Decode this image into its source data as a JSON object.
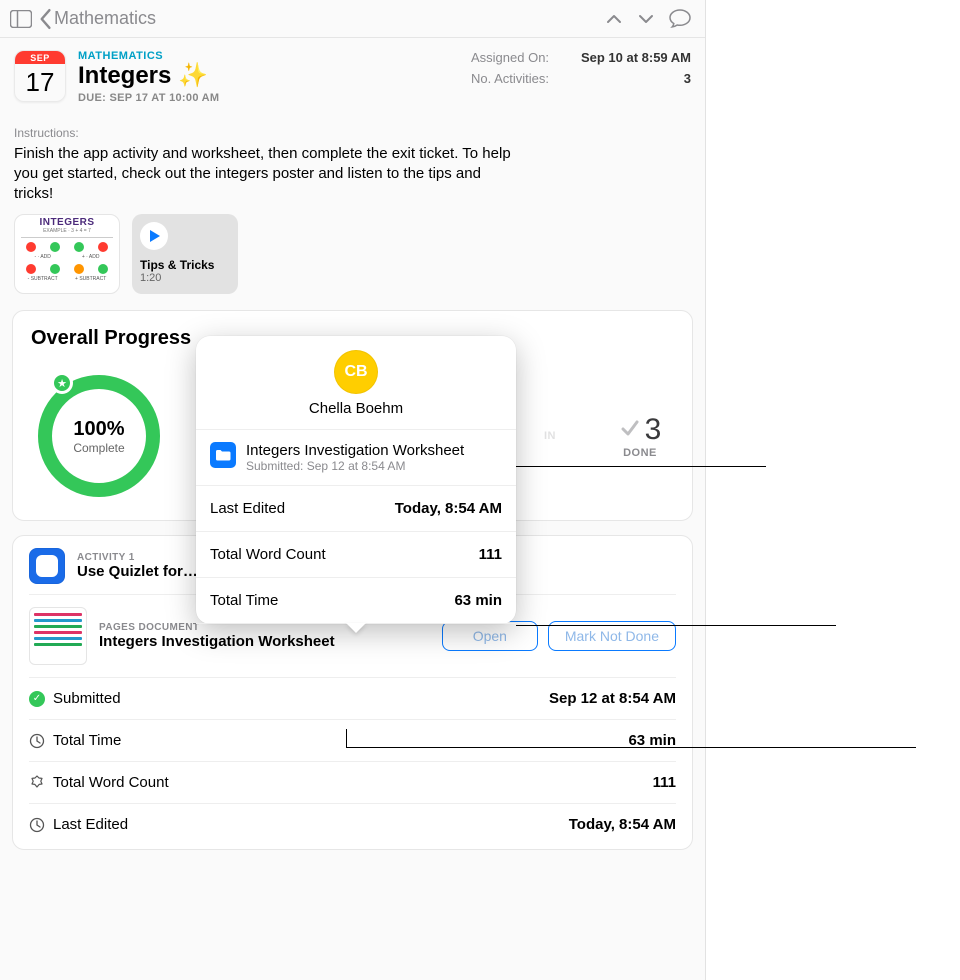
{
  "nav": {
    "back_label": "Mathematics"
  },
  "header": {
    "cal_month": "SEP",
    "cal_day": "17",
    "subject": "MATHEMATICS",
    "title": "Integers ✨",
    "due": "DUE: SEP 17 AT 10:00 AM",
    "meta": {
      "assigned_label": "Assigned On:",
      "assigned_value": "Sep 10 at 8:59 AM",
      "activities_label": "No. Activities:",
      "activities_value": "3"
    }
  },
  "instructions": {
    "label": "Instructions:",
    "text": "Finish the app activity and worksheet, then complete the exit ticket. To help you get started, check out the integers poster and listen to the tips and tricks!"
  },
  "attachments": {
    "poster_title": "INTEGERS",
    "media_title": "Tips & Tricks",
    "media_duration": "1:20"
  },
  "progress": {
    "heading": "Overall Progress",
    "percent": "100%",
    "percent_sub": "Complete",
    "done_num": "3",
    "done_label": "DONE"
  },
  "activity": {
    "label": "ACTIVITY 1",
    "title": "Use Quizlet for…",
    "doc_label": "PAGES DOCUMENT",
    "doc_title": "Integers Investigation Worksheet",
    "open_btn": "Open",
    "mark_btn": "Mark Not Done",
    "rows": {
      "submitted_label": "Submitted",
      "submitted_value": "Sep 12 at 8:54 AM",
      "time_label": "Total Time",
      "time_value": "63 min",
      "words_label": "Total Word Count",
      "words_value": "111",
      "edited_label": "Last Edited",
      "edited_value": "Today, 8:54 AM"
    }
  },
  "popover": {
    "initials": "CB",
    "student": "Chella Boehm",
    "file_title": "Integers Investigation Worksheet",
    "file_sub": "Submitted: Sep 12 at 8:54 AM",
    "rows": {
      "edited_label": "Last Edited",
      "edited_value": "Today, 8:54 AM",
      "words_label": "Total Word Count",
      "words_value": "111",
      "time_label": "Total Time",
      "time_value": "63 min"
    }
  },
  "hidden_stat": {
    "suffix": "IN"
  }
}
